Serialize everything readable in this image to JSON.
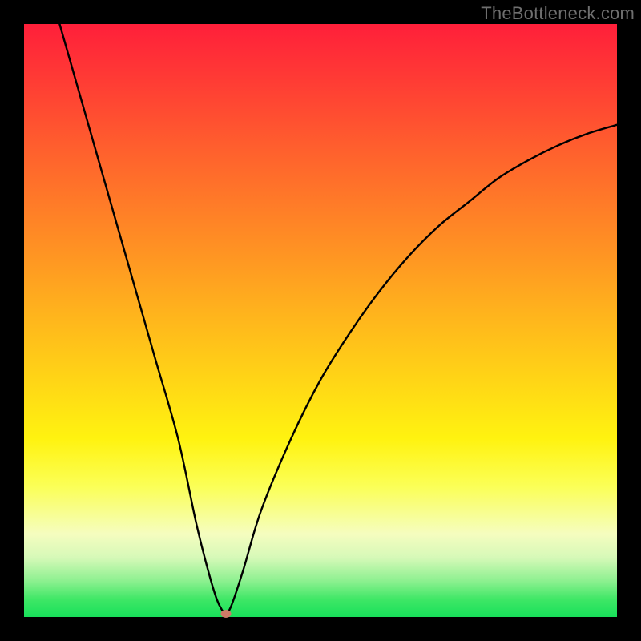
{
  "watermark": "TheBottleneck.com",
  "chart_data": {
    "type": "line",
    "title": "",
    "xlabel": "",
    "ylabel": "",
    "xlim": [
      0,
      100
    ],
    "ylim": [
      0,
      100
    ],
    "grid": false,
    "legend": false,
    "series": [
      {
        "name": "bottleneck-curve",
        "x": [
          6,
          10,
          14,
          18,
          22,
          26,
          29,
          31,
          32.5,
          33.5,
          34,
          35,
          37,
          40,
          45,
          50,
          55,
          60,
          65,
          70,
          75,
          80,
          85,
          90,
          95,
          100
        ],
        "y": [
          100,
          86,
          72,
          58,
          44,
          30,
          16,
          8,
          3,
          1,
          0.5,
          2,
          8,
          18,
          30,
          40,
          48,
          55,
          61,
          66,
          70,
          74,
          77,
          79.5,
          81.5,
          83
        ]
      }
    ],
    "min_marker": {
      "x": 34,
      "y": 0.5,
      "color": "#cf7a68"
    },
    "background_gradient": {
      "top": "#ff1f3a",
      "mid": "#ffd516",
      "bottom": "#18e05a"
    }
  }
}
